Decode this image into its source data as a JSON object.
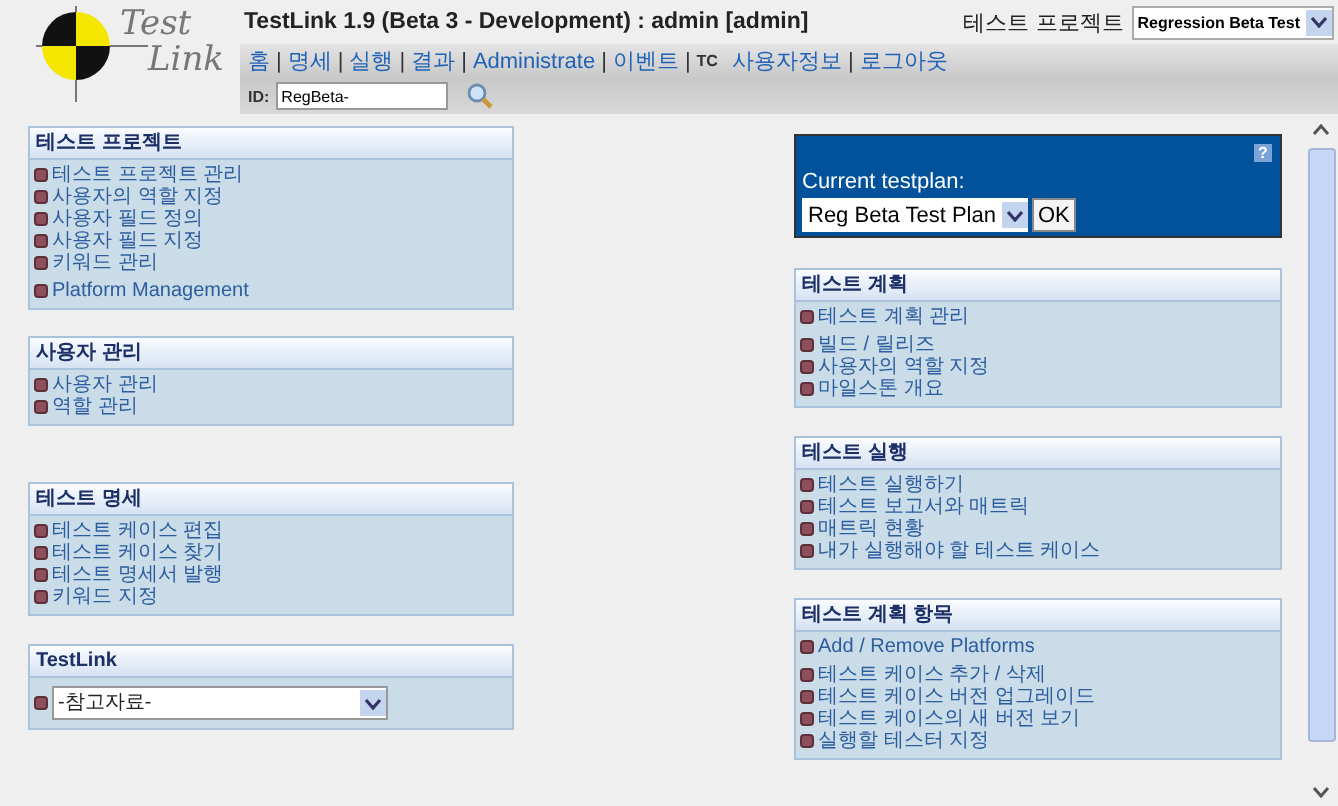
{
  "header": {
    "logo": {
      "line_1": "Test",
      "line_2": "Link"
    },
    "title": "TestLink 1.9 (Beta 3 - Development) : admin [admin]",
    "project_label": "테스트 프로젝트",
    "project_select": "Regression Beta Test",
    "nav": [
      {
        "kind": "link",
        "label": "홈"
      },
      {
        "kind": "sep",
        "label": "|"
      },
      {
        "kind": "link",
        "label": "명세"
      },
      {
        "kind": "sep",
        "label": "|"
      },
      {
        "kind": "link",
        "label": "실행"
      },
      {
        "kind": "sep",
        "label": "|"
      },
      {
        "kind": "link",
        "label": "결과"
      },
      {
        "kind": "sep",
        "label": "|"
      },
      {
        "kind": "link",
        "label": "Administrate"
      },
      {
        "kind": "sep",
        "label": "|"
      },
      {
        "kind": "link",
        "label": "이벤트"
      },
      {
        "kind": "sep",
        "label": "|"
      },
      {
        "kind": "tag",
        "label": "TC"
      },
      {
        "kind": "link",
        "label": "사용자정보"
      },
      {
        "kind": "sep",
        "label": "|"
      },
      {
        "kind": "link",
        "label": "로그아웃"
      }
    ],
    "id_label": "ID:",
    "id_value": "RegBeta-"
  },
  "left_panels": [
    {
      "title": "테스트 프로젝트",
      "items": [
        {
          "kind": "link",
          "label": "테스트 프로젝트 관리"
        },
        {
          "kind": "link",
          "label": "사용자의 역할 지정"
        },
        {
          "kind": "link",
          "label": "사용자 필드 정의"
        },
        {
          "kind": "link",
          "label": "사용자 필드 지정"
        },
        {
          "kind": "link",
          "label": "키워드 관리"
        },
        {
          "kind": "link",
          "label": "Platform Management"
        }
      ]
    },
    {
      "title": "사용자 관리",
      "items": [
        {
          "kind": "link",
          "label": "사용자 관리"
        },
        {
          "kind": "link",
          "label": "역할 관리"
        }
      ]
    },
    {
      "title": "테스트 명세",
      "items": [
        {
          "kind": "link",
          "label": "테스트 케이스 편집"
        },
        {
          "kind": "link",
          "label": "테스트 케이스 찾기"
        },
        {
          "kind": "link",
          "label": "테스트 명세서 발행"
        },
        {
          "kind": "link",
          "label": "키워드 지정"
        }
      ]
    },
    {
      "title": "TestLink",
      "items": [
        {
          "kind": "select",
          "label": "-참고자료-"
        }
      ]
    }
  ],
  "testplan": {
    "help": "?",
    "label": "Current testplan:",
    "select": "Reg Beta Test Plan",
    "button": "OK"
  },
  "right_panels": [
    {
      "title": "테스트 계획",
      "items": [
        {
          "kind": "link",
          "label": "테스트 계획 관리"
        },
        {
          "kind": "link",
          "label": "빌드 / 릴리즈"
        },
        {
          "kind": "link",
          "label": "사용자의 역할 지정"
        },
        {
          "kind": "link",
          "label": "마일스톤 개요"
        }
      ]
    },
    {
      "title": "테스트 실행",
      "items": [
        {
          "kind": "link",
          "label": "테스트 실행하기"
        },
        {
          "kind": "link",
          "label": "테스트 보고서와 매트릭"
        },
        {
          "kind": "link",
          "label": "매트릭 현황"
        },
        {
          "kind": "link",
          "label": "내가 실행해야 할 테스트 케이스"
        }
      ]
    },
    {
      "title": "테스트 계획 항목",
      "items": [
        {
          "kind": "link",
          "label": "Add / Remove Platforms"
        },
        {
          "kind": "link",
          "label": "테스트 케이스 추가 / 삭제"
        },
        {
          "kind": "link",
          "label": "테스트 케이스 버전 업그레이드"
        },
        {
          "kind": "link",
          "label": "테스트 케이스의 새 버전 보기"
        },
        {
          "kind": "link",
          "label": "실행할 테스터 지정"
        }
      ]
    }
  ]
}
